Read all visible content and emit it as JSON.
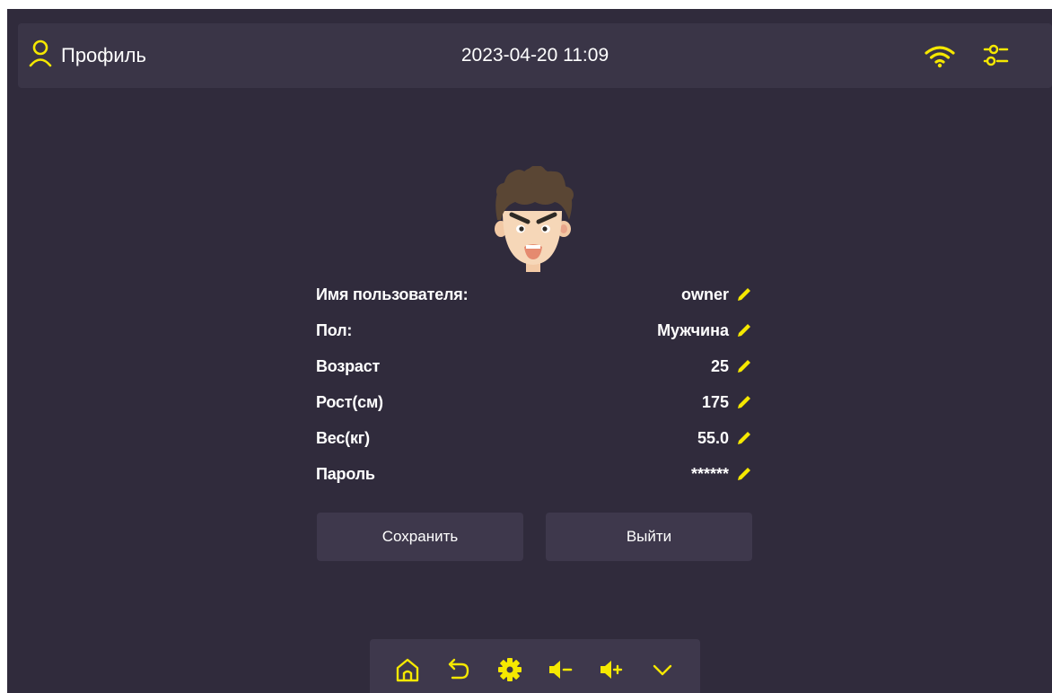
{
  "header": {
    "title": "Профиль",
    "datetime": "2023-04-20 11:09",
    "user_icon": "user-icon",
    "wifi_icon": "wifi-icon",
    "settings_icon": "sliders-icon"
  },
  "profile": {
    "avatar": "avatar-face",
    "fields": [
      {
        "label": "Имя пользователя:",
        "value": "owner"
      },
      {
        "label": "Пол:",
        "value": "Мужчина"
      },
      {
        "label": "Возраст",
        "value": "25"
      },
      {
        "label": "Рост(см)",
        "value": "175"
      },
      {
        "label": "Вес(кг)",
        "value": "55.0"
      },
      {
        "label": "Пароль",
        "value": "******"
      }
    ]
  },
  "buttons": {
    "save": "Сохранить",
    "logout": "Выйти"
  },
  "bottom_bar": [
    "home-icon",
    "back-icon",
    "settings-gear-icon",
    "volume-down-icon",
    "volume-up-icon",
    "chevron-down-icon"
  ],
  "colors": {
    "accent": "#f5e800",
    "background": "#302b3c",
    "panel": "#3a3547",
    "button": "#3e384c",
    "text": "#ffffff"
  }
}
